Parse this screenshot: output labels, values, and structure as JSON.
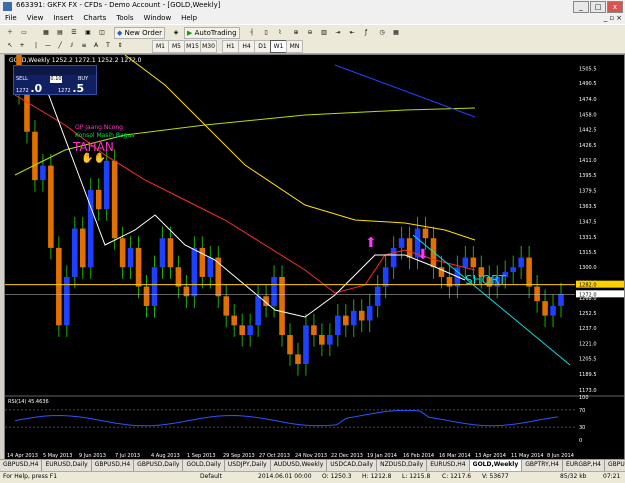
{
  "window": {
    "title": "663391: GKFX FX - CFDs - Demo Account - [GOLD,Weekly]",
    "minimize": "_",
    "maximize": "□",
    "close": "x"
  },
  "menu": [
    "File",
    "View",
    "Insert",
    "Charts",
    "Tools",
    "Window",
    "Help"
  ],
  "toolbar": {
    "new_order": "New Order",
    "autotrading": "AutoTrading",
    "timeframes": [
      "M1",
      "M5",
      "M15",
      "M30",
      "H1",
      "H4",
      "D1",
      "W1",
      "MN"
    ],
    "active_timeframe": "W1"
  },
  "chart": {
    "header": "GOLD,Weekly  1252.2 1272.1 1252.2 1272.0",
    "symbol": "GOLD",
    "timeframe": "Weekly",
    "trade_panel": {
      "sell_label": "SELL",
      "buy_label": "BUY",
      "lot": "0.10",
      "sell_price_prefix": "1272",
      "sell_price_big": ".0",
      "buy_price_prefix": "1272",
      "buy_price_big": ".5"
    },
    "annotations": {
      "note_line1": "OP Jaang Ncong",
      "note_line2": "Konsol Masih Bagus",
      "note_line3": "TAHAN",
      "short_label": "SHORT"
    },
    "price_axis": [
      "1505.5",
      "1490.5",
      "1474.0",
      "1458.0",
      "1442.5",
      "1426.5",
      "1411.0",
      "1395.5",
      "1379.5",
      "1363.5",
      "1347.5",
      "1331.5",
      "1315.5",
      "1300.0",
      "1284.0",
      "1268.0",
      "1252.5",
      "1237.0",
      "1221.0",
      "1205.5",
      "1189.5",
      "1173.0"
    ],
    "current_price": "1272.0",
    "highlight_price": "1282.0",
    "date_axis": [
      "14 Apr 2013",
      "5 May 2013",
      "9 Jun 2013",
      "7 Jul 2013",
      "4 Aug 2013",
      "1 Sep 2013",
      "29 Sep 2013",
      "27 Oct 2013",
      "24 Nov 2013",
      "22 Dec 2013",
      "19 Jan 2014",
      "16 Feb 2014",
      "16 Mar 2014",
      "13 Apr 2014",
      "11 May 2014",
      "8 Jun 2014"
    ],
    "rsi": {
      "label": "RSI(14) 45.4636",
      "axis": [
        "100",
        "70",
        "30",
        "0"
      ]
    },
    "colors": {
      "bull": "#1e40ff",
      "bear": "#e07000",
      "ma_white": "#ffffff",
      "ma_red": "#ff2a2a",
      "ma_yellow": "#ffe000",
      "ma_green": "#b6e000",
      "trend_blue": "#2a3cff",
      "trend_cyan": "#00e0e0",
      "support": "#ffd000",
      "rsi_line": "#2c55ff"
    }
  },
  "tabs": [
    "GBPUSD,H4",
    "EURUSD,Daily",
    "GBPUSD,H4",
    "GBPUSD,Daily",
    "GOLD,Daily",
    "USDJPY,Daily",
    "AUDUSD,Weekly",
    "USDCAD,Daily",
    "NZDUSD,Daily",
    "EURUSD,H4",
    "GOLD,Weekly",
    "GBPTRY,H4",
    "EURGBP,H4",
    "GBPUSE"
  ],
  "active_tab": "GOLD,Weekly",
  "status": {
    "help": "For Help, press F1",
    "default": "Default",
    "time": "2014.06.01 00:00",
    "open": "O: 1250.3",
    "high": "H: 1212.8",
    "low": "L: 1215.8",
    "close": "C: 1217.6",
    "volume": "V: 53677",
    "kb": "85/32 kb",
    "clock": "07:21"
  }
}
